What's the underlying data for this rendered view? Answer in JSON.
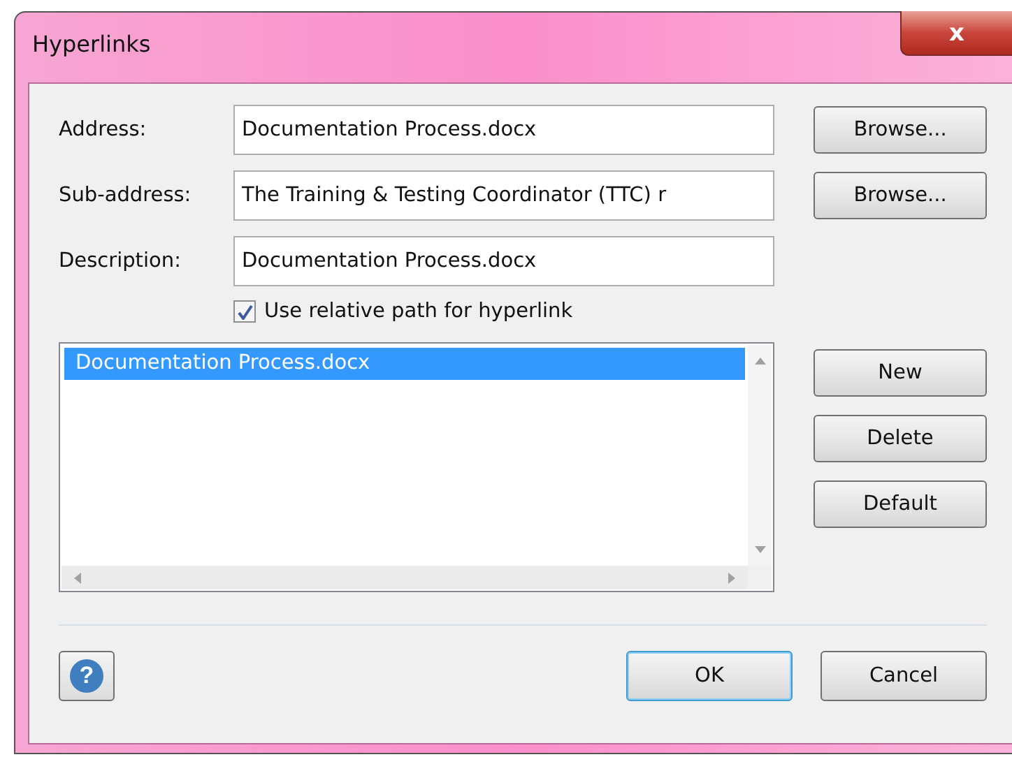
{
  "window": {
    "title": "Hyperlinks",
    "close": "x"
  },
  "fields": [
    {
      "label": "Address:",
      "value": "Documentation Process.docx",
      "button": "Browse..."
    },
    {
      "label": "Sub-address:",
      "value": "The Training & Testing Coordinator (TTC) r",
      "button": "Browse..."
    },
    {
      "label": "Description:",
      "value": "Documentation Process.docx"
    }
  ],
  "relative_path": {
    "label": "Use relative path for hyperlink",
    "checked": true
  },
  "list": {
    "items": [
      {
        "label": "Documentation Process.docx",
        "selected": true
      }
    ]
  },
  "side_buttons": [
    "New",
    "Delete",
    "Default"
  ],
  "footer": {
    "help": "?",
    "buttons": [
      {
        "label": "OK",
        "default": true
      },
      {
        "label": "Cancel",
        "default": false
      }
    ]
  }
}
